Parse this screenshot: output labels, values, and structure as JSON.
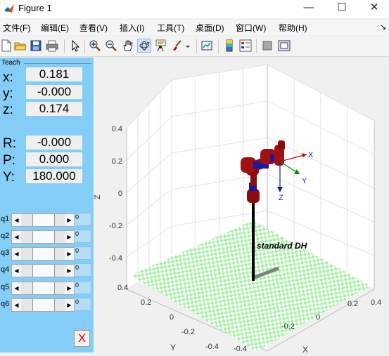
{
  "window": {
    "title": "Figure 1",
    "minimize": "—",
    "maximize": "☐",
    "close": "✕"
  },
  "menu": [
    "文件(F)",
    "编辑(E)",
    "查看(V)",
    "插入(I)",
    "工具(T)",
    "桌面(D)",
    "窗口(W)",
    "帮助(H)"
  ],
  "menu_dock_arrow": "↘",
  "toolbar": {
    "icons": [
      "new-figure-icon",
      "open-file-icon",
      "save-icon",
      "print-icon",
      "edit-plot-arrow-icon",
      "zoom-in-icon",
      "zoom-out-icon",
      "pan-hand-icon",
      "rotate-3d-icon",
      "data-cursor-icon",
      "brush-icon",
      "link-plot-icon",
      "colorbar-icon",
      "legend-icon",
      "hide-plot-tools-icon",
      "show-plot-tools-icon"
    ],
    "active": "rotate-3d-icon"
  },
  "teach": {
    "title": "Teach",
    "position": [
      {
        "label": "x:",
        "value": "0.181"
      },
      {
        "label": "y:",
        "value": "-0.000"
      },
      {
        "label": "z:",
        "value": "0.174"
      }
    ],
    "orientation": [
      {
        "label": "R:",
        "value": "-0.000"
      },
      {
        "label": "P:",
        "value": "0.000"
      },
      {
        "label": "Y:",
        "value": "180.000"
      }
    ],
    "joints": [
      {
        "label": "q1",
        "value": "0"
      },
      {
        "label": "q2",
        "value": "0"
      },
      {
        "label": "q3",
        "value": "0"
      },
      {
        "label": "q4",
        "value": "0"
      },
      {
        "label": "q5",
        "value": "0"
      },
      {
        "label": "q6",
        "value": "0"
      }
    ],
    "slider_left_arrow": "◀",
    "slider_right_arrow": "▶",
    "quit_label": "X"
  },
  "plot": {
    "robot_label": "standard DH",
    "z_axis_label": "Z",
    "x_axis_label": "X",
    "y_axis_label": "Y",
    "z_ticks": [
      "0.4",
      "0.2",
      "0",
      "-0.2",
      "-0.4"
    ],
    "y_ticks": [
      "0.4",
      "0.2",
      "0",
      "-0.2",
      "-0.4"
    ],
    "x_ticks": [
      "-0.4",
      "-0.2",
      "0",
      "0.2",
      "0.4"
    ],
    "frame_labels": {
      "x": "X",
      "y": "Y",
      "z": "Z"
    },
    "colors": {
      "link": "#8b0d0d",
      "joint_blue": "#1717a8",
      "floor": "#a6f0a6",
      "base": "#000000"
    }
  }
}
